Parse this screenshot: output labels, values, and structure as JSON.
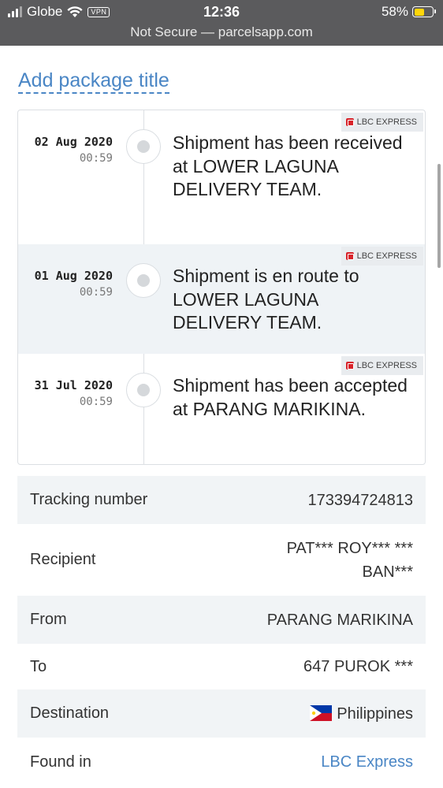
{
  "status_bar": {
    "carrier": "Globe",
    "vpn": "VPN",
    "time": "12:36",
    "battery": "58%",
    "battery_level": 0.58
  },
  "browser": {
    "url_text": "Not Secure — parcelsapp.com"
  },
  "page": {
    "add_title_link": "Add package title"
  },
  "timeline": {
    "events": [
      {
        "date": "02 Aug 2020",
        "time": "00:59",
        "carrier": "LBC EXPRESS",
        "description": "Shipment has been received at LOWER LAGUNA DELIVERY TEAM."
      },
      {
        "date": "01 Aug 2020",
        "time": "00:59",
        "carrier": "LBC EXPRESS",
        "description": "Shipment is en route to LOWER LAGUNA DELIVERY TEAM."
      },
      {
        "date": "31 Jul 2020",
        "time": "00:59",
        "carrier": "LBC EXPRESS",
        "description": "Shipment has been accepted at PARANG MARIKINA."
      }
    ]
  },
  "details": {
    "tracking_number": {
      "label": "Tracking number",
      "value": "173394724813"
    },
    "recipient": {
      "label": "Recipient",
      "value_line1": "PAT*** ROY*** ***",
      "value_line2": "BAN***"
    },
    "from": {
      "label": "From",
      "value": "PARANG MARIKINA"
    },
    "to": {
      "label": "To",
      "value": "647 PUROK ***"
    },
    "destination": {
      "label": "Destination",
      "value": "Philippines",
      "flag_icon": "philippines-flag-icon"
    },
    "found_in": {
      "label": "Found in",
      "value": "LBC Express"
    }
  },
  "colors": {
    "link": "#4a86c5",
    "status_bar_bg": "#5b5b5d",
    "shaded_row": "#f1f4f6",
    "battery": "#ffd60a"
  }
}
